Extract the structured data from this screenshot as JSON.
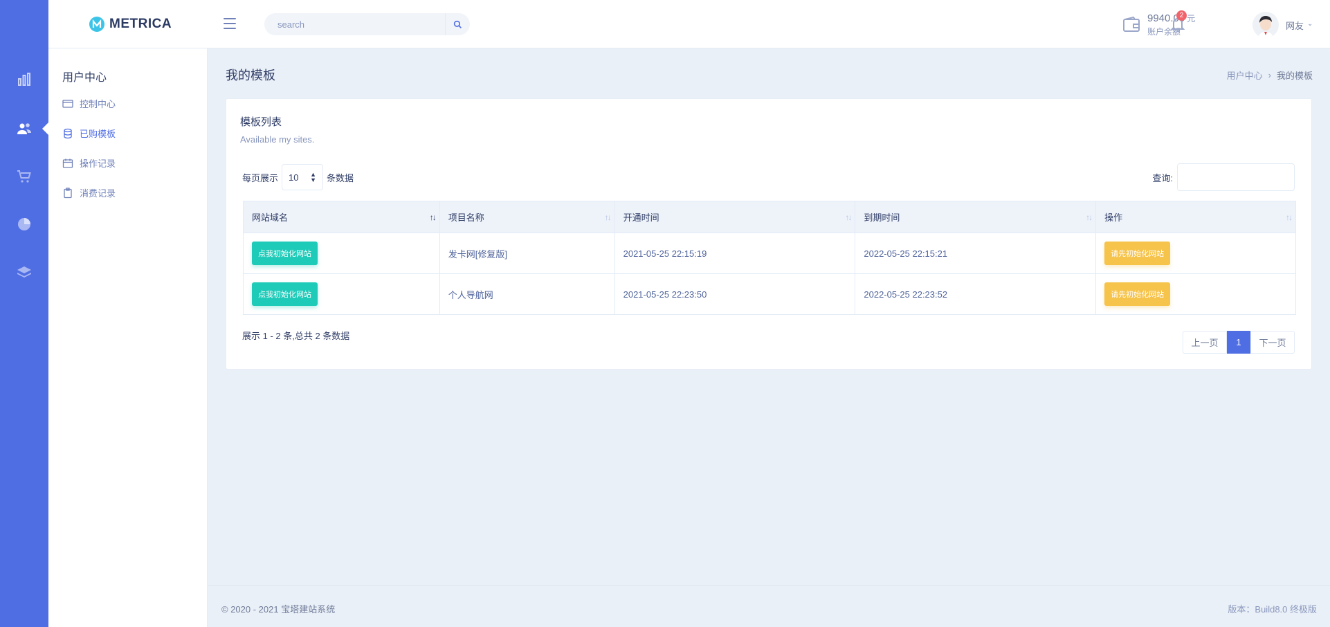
{
  "header": {
    "brand": "METRICA",
    "search_placeholder": "search",
    "wallet": {
      "amount": "9940.00",
      "unit": "元",
      "label": "账户余额"
    },
    "notifications_count": "2",
    "user_name": "网友"
  },
  "rail": {
    "icons": [
      "bar-chart-icon",
      "users-icon",
      "cart-icon",
      "pie-chart-icon",
      "layers-icon"
    ],
    "active_index": 1
  },
  "sidebar": {
    "title": "用户中心",
    "items": [
      {
        "label": "控制中心",
        "icon": "credit-card-icon",
        "active": false
      },
      {
        "label": "已购模板",
        "icon": "database-icon",
        "active": true
      },
      {
        "label": "操作记录",
        "icon": "calendar-icon",
        "active": false
      },
      {
        "label": "消费记录",
        "icon": "clipboard-icon",
        "active": false
      }
    ]
  },
  "page": {
    "title": "我的模板",
    "breadcrumb": [
      "用户中心",
      "我的模板"
    ]
  },
  "card": {
    "title": "模板列表",
    "subtitle": "Available my sites.",
    "length_prefix": "每页展示",
    "length_value": "10",
    "length_suffix": "条数据",
    "filter_label": "查询:",
    "columns": [
      "网站域名",
      "项目名称",
      "开通时间",
      "到期时间",
      "操作"
    ],
    "rows": [
      {
        "domain_button": "点我初始化网站",
        "project": "发卡网[修复版]",
        "start": "2021-05-25 22:15:19",
        "expire": "2022-05-25 22:15:21",
        "action": "请先初始化网站"
      },
      {
        "domain_button": "点我初始化网站",
        "project": "个人导航网",
        "start": "2021-05-25 22:23:50",
        "expire": "2022-05-25 22:23:52",
        "action": "请先初始化网站"
      }
    ],
    "info": "展示 1 - 2 条,总共 2 条数据",
    "pager": {
      "prev": "上一页",
      "current": "1",
      "next": "下一页"
    }
  },
  "footer": {
    "copyright": "© 2020 - 2021 宝塔建站系统",
    "version": "版本：Build8.0 终极版"
  },
  "colors": {
    "rail": "#506ee4",
    "accent": "#506ee4",
    "teal": "#1ecab8",
    "warning": "#f6c34b",
    "badge": "#f1646c"
  }
}
